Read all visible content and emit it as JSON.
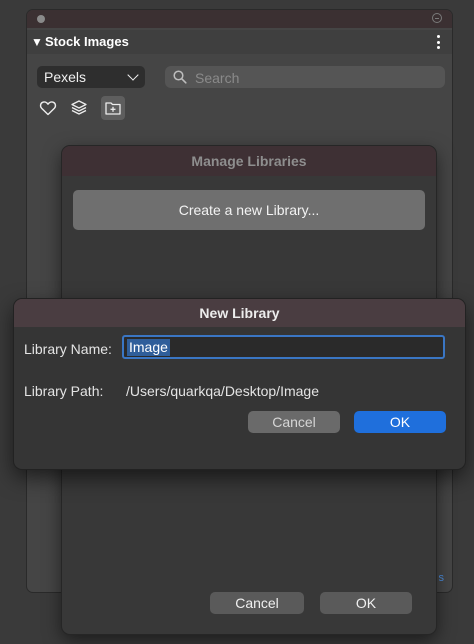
{
  "panel": {
    "title": "Stock Images",
    "source": "Pexels",
    "search_placeholder": "Search",
    "corner_text": "s"
  },
  "manage_dialog": {
    "title": "Manage Libraries",
    "create_label": "Create a new Library...",
    "cancel_label": "Cancel",
    "ok_label": "OK"
  },
  "new_library_dialog": {
    "title": "New Library",
    "name_label": "Library Name:",
    "name_value": "Image",
    "path_label": "Library Path:",
    "path_value": "/Users/quarkqa/Desktop/Image",
    "cancel_label": "Cancel",
    "ok_label": "OK"
  },
  "colors": {
    "accent": "#1f6fdc",
    "dialog_title_bg": "#4a3d41"
  },
  "icons": [
    "heart-icon",
    "layers-icon",
    "add-folder-icon",
    "search-icon",
    "more-icon",
    "disclosure-triangle-icon"
  ]
}
